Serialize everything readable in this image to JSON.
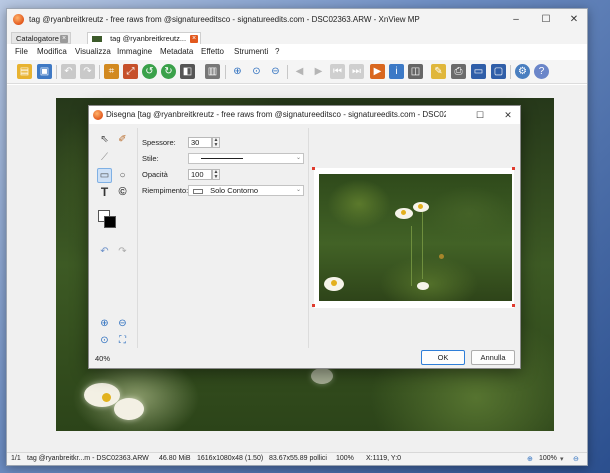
{
  "window": {
    "title": "tag @ryanbreitkreutz - free raws from @signatureeditsco - signatureedits.com - DSC02363.ARW - XnView MP",
    "minimize": "–",
    "maximize": "☐",
    "close": "✕"
  },
  "tabs": [
    {
      "label": "Catalogatore",
      "close": "×"
    },
    {
      "label": "tag @ryanbreitkreutz...",
      "close": "×"
    }
  ],
  "menu": [
    "File",
    "Modifica",
    "Visualizza",
    "Immagine",
    "Metadata",
    "Effetto",
    "Strumenti",
    "?"
  ],
  "toolbar": {
    "icons": [
      "open-folder-icon",
      "save-icon",
      "undo-icon",
      "redo-icon",
      "crop-icon",
      "resize-icon",
      "rotate-left-icon",
      "rotate-right-icon",
      "adjust-icon",
      "histogram-icon",
      "zoom-in-icon",
      "zoom-fit-icon",
      "zoom-out-icon",
      "previous-icon",
      "next-icon",
      "first-icon",
      "last-icon",
      "slideshow-icon",
      "info-icon",
      "compare-icon",
      "draw-icon",
      "print-icon",
      "wallpaper-icon",
      "fullscreen-icon",
      "settings-icon",
      "help-icon"
    ]
  },
  "status": {
    "position": "1/1",
    "filename": "tag @ryanbreitkr...m - DSC02363.ARW",
    "filesize": "46.80 MiB",
    "dimensions": "1616x1080x48 (1.50)",
    "print_size": "83.67x55.89 pollici",
    "zoom": "100%",
    "coords": "X:1119, Y:0",
    "zoom_right": "100%"
  },
  "dialog": {
    "title": "Disegna [tag @ryanbreitkreutz - free raws from @signatureeditsco - signatureedits.com - DSC0236...",
    "maximize": "☐",
    "close": "✕",
    "props": {
      "thickness_label": "Spessore:",
      "thickness_value": "30",
      "style_label": "Stile:",
      "opacity_label": "Opacità",
      "opacity_value": "100",
      "fill_label": "Riempimento:",
      "fill_value": "Solo Contorno"
    },
    "zoom": "40%",
    "ok": "OK",
    "cancel": "Annulla"
  },
  "colors": {
    "accent": "#2f7ed8",
    "tab_close": "#e2581d",
    "handle": "#e03b2e"
  }
}
